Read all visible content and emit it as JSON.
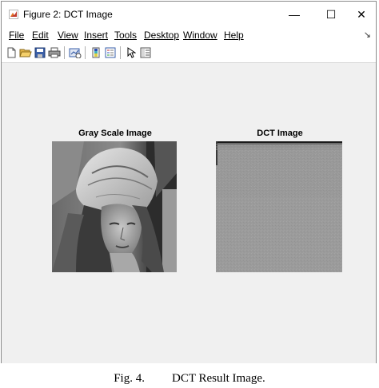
{
  "window": {
    "title": "Figure 2: DCT Image",
    "minimize_glyph": "—",
    "maximize_glyph": "☐",
    "close_glyph": "✕"
  },
  "menu": [
    {
      "label": "File"
    },
    {
      "label": "Edit"
    },
    {
      "label": "View"
    },
    {
      "label": "Insert"
    },
    {
      "label": "Tools"
    },
    {
      "label": "Desktop"
    },
    {
      "label": "Window"
    },
    {
      "label": "Help"
    }
  ],
  "toolbar_icons": [
    "new-figure-icon",
    "open-file-icon",
    "save-icon",
    "print-icon",
    "link-plot-icon",
    "colorbar-icon",
    "legend-icon",
    "pointer-icon",
    "property-inspector-icon"
  ],
  "axes": [
    {
      "title": "Gray Scale Image"
    },
    {
      "title": "DCT Image"
    }
  ],
  "caption": {
    "figure": "Fig. 4.",
    "text": "DCT Result Image."
  }
}
